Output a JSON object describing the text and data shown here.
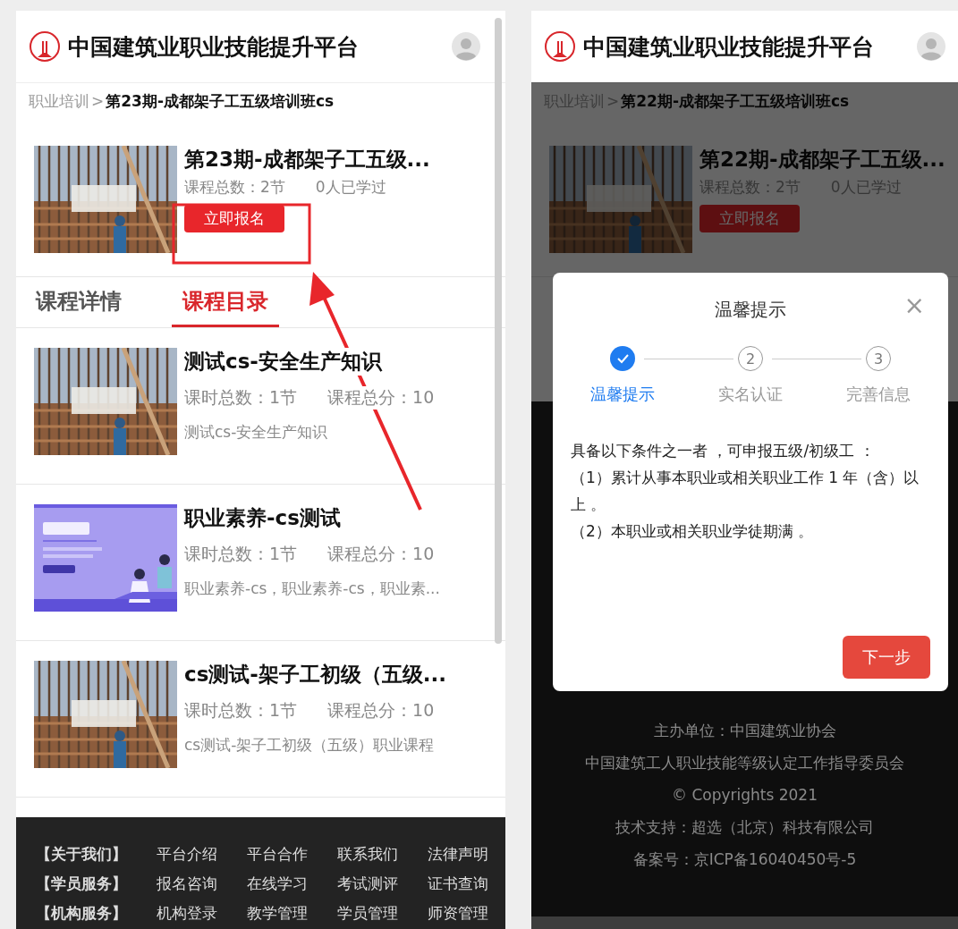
{
  "left_screen": {
    "header": {
      "title": "中国建筑业职业技能提升平台"
    },
    "breadcrumb": {
      "parent": "职业培训",
      "separator": ">",
      "current": "第23期-成都架子工五级培训班cs"
    },
    "course": {
      "title": "第23期-成都架子工五级...",
      "lesson_count": "课程总数：2节",
      "learners": "0人已学过",
      "enroll_button": "立即报名"
    },
    "tabs": [
      {
        "label": "课程详情",
        "selected": false
      },
      {
        "label": "课程目录",
        "selected": true
      }
    ],
    "lessons": [
      {
        "kind": "scaffold",
        "title": "测试cs-安全生产知识",
        "hours": "课时总数：1节",
        "score": "课程总分：10",
        "description": "测试cs-安全生产知识"
      },
      {
        "kind": "banner",
        "title": "职业素养-cs测试",
        "hours": "课时总数：1节",
        "score": "课程总分：10",
        "description": "职业素养-cs，职业素养-cs，职业素..."
      },
      {
        "kind": "scaffold",
        "title": "cs测试-架子工初级（五级...",
        "hours": "课时总数：1节",
        "score": "课程总分：10",
        "description": "cs测试-架子工初级（五级）职业课程"
      }
    ],
    "footer_links": [
      {
        "category": "【关于我们】",
        "links": [
          "平台介绍",
          "平台合作",
          "联系我们",
          "法律声明"
        ]
      },
      {
        "category": "【学员服务】",
        "links": [
          "报名咨询",
          "在线学习",
          "考试测评",
          "证书查询"
        ]
      },
      {
        "category": "【机构服务】",
        "links": [
          "机构登录",
          "教学管理",
          "学员管理",
          "师资管理"
        ]
      }
    ]
  },
  "right_screen": {
    "header": {
      "title": "中国建筑业职业技能提升平台"
    },
    "breadcrumb": {
      "parent": "职业培训",
      "separator": ">",
      "current": "第22期-成都架子工五级培训班cs"
    },
    "course": {
      "title": "第22期-成都架子工五级...",
      "lesson_count": "课程总数：2节",
      "learners": "0人已学过",
      "enroll_button": "立即报名"
    },
    "footer_info": [
      "主办单位：中国建筑业协会",
      "中国建筑工人职业技能等级认定工作指导委员会",
      "© Copyrights 2021",
      "技术支持：超选（北京）科技有限公司",
      "备案号：京ICP备16040450号-5"
    ],
    "dialog": {
      "title": "温馨提示",
      "close": "×",
      "steps": [
        {
          "label": "温馨提示",
          "selected": true
        },
        {
          "number": "2",
          "label": "实名认证",
          "selected": false
        },
        {
          "number": "3",
          "label": "完善信息",
          "selected": false
        }
      ],
      "body": [
        "具备以下条件之一者 ，可申报五级/初级工 ：",
        "（1）累计从事本职业或相关职业工作 1 年（含）以上 。",
        "（2）本职业或相关职业学徒期满 。"
      ],
      "next_button": "下一步"
    }
  }
}
